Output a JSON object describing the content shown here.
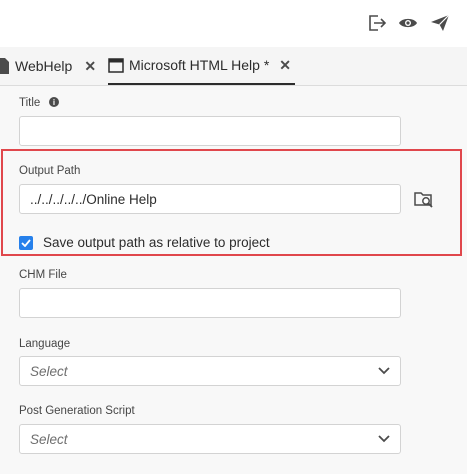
{
  "toolbar": {
    "icons": [
      "exit-icon",
      "eye-icon",
      "send-icon"
    ]
  },
  "tabs": [
    {
      "label": "WebHelp",
      "close": "✕",
      "active": false
    },
    {
      "label": "Microsoft HTML Help *",
      "close": "✕",
      "active": true
    }
  ],
  "form": {
    "title": {
      "label": "Title",
      "value": ""
    },
    "output_path": {
      "label": "Output Path",
      "value": "../../../../../Online Help"
    },
    "relative_checkbox": {
      "label": "Save output path as relative to project",
      "checked": true
    },
    "chm_file": {
      "label": "CHM File",
      "value": ""
    },
    "language": {
      "label": "Language",
      "placeholder": "Select"
    },
    "post_generation_script": {
      "label": "Post Generation Script",
      "placeholder": "Select"
    }
  },
  "colors": {
    "highlight": "#e0474c",
    "checkbox": "#2680eb"
  }
}
